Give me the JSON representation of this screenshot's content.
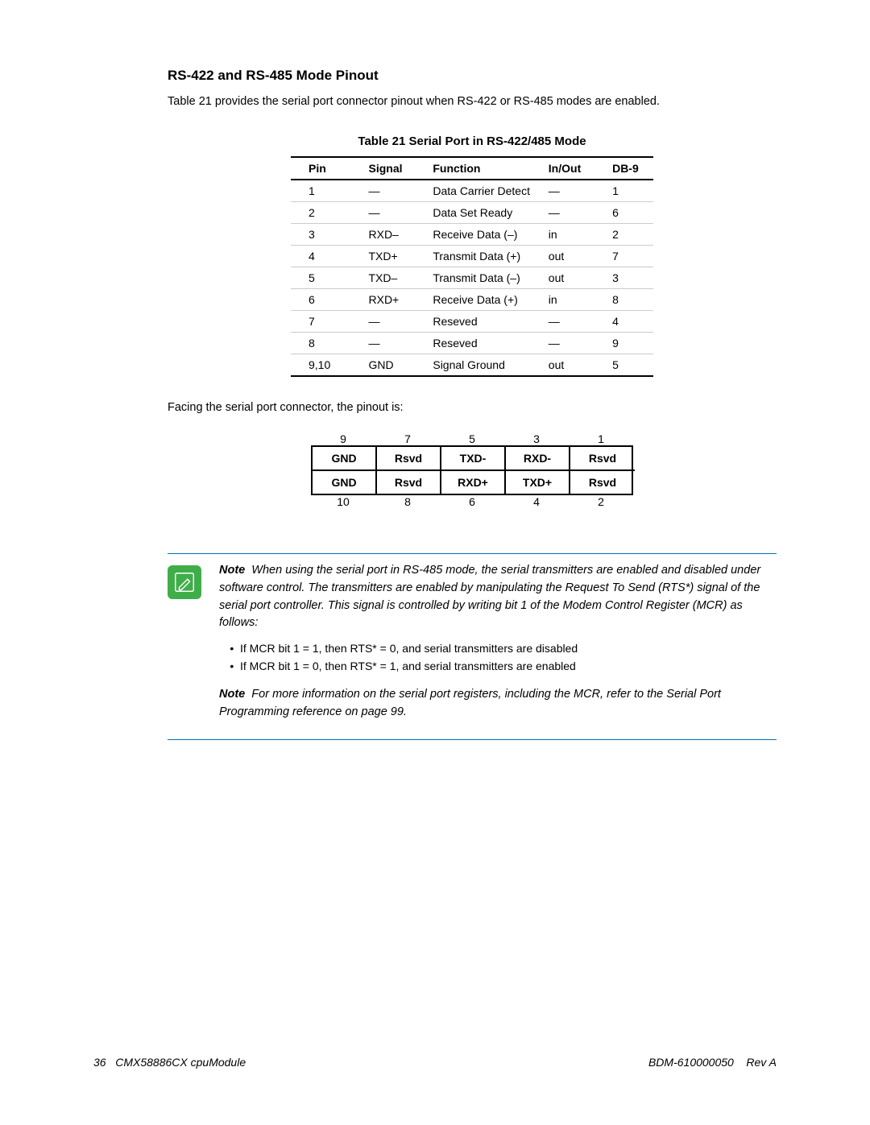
{
  "heading": "RS-422 and RS-485 Mode Pinout",
  "intro": "Table 21 provides the serial port connector pinout when RS-422 or RS-485 modes are enabled.",
  "table_caption": "Table 21     Serial Port in RS-422/485 Mode",
  "table": {
    "headers": {
      "pin": "Pin",
      "signal": "Signal",
      "function": "Function",
      "inout": "In/Out",
      "db9": "DB-9"
    },
    "rows": [
      {
        "pin": "1",
        "signal": "—",
        "function": "Data Carrier Detect",
        "inout": "—",
        "db9": "1"
      },
      {
        "pin": "2",
        "signal": "—",
        "function": "Data Set Ready",
        "inout": "—",
        "db9": "6"
      },
      {
        "pin": "3",
        "signal": "RXD–",
        "function": "Receive Data (–)",
        "inout": "in",
        "db9": "2"
      },
      {
        "pin": "4",
        "signal": "TXD+",
        "function": "Transmit Data (+)",
        "inout": "out",
        "db9": "7"
      },
      {
        "pin": "5",
        "signal": "TXD–",
        "function": "Transmit Data (–)",
        "inout": "out",
        "db9": "3"
      },
      {
        "pin": "6",
        "signal": "RXD+",
        "function": "Receive Data (+)",
        "inout": "in",
        "db9": "8"
      },
      {
        "pin": "7",
        "signal": "—",
        "function": "Reseved",
        "inout": "—",
        "db9": "4"
      },
      {
        "pin": "8",
        "signal": "—",
        "function": "Reseved",
        "inout": "—",
        "db9": "9"
      },
      {
        "pin": "9,10",
        "signal": "GND",
        "function": "Signal Ground",
        "inout": "out",
        "db9": "5"
      }
    ]
  },
  "facing_text": "Facing the serial port connector, the pinout is:",
  "pin_diagram": {
    "top_numbers": [
      "9",
      "7",
      "5",
      "3",
      "1"
    ],
    "row1": [
      "GND",
      "Rsvd",
      "TXD-",
      "RXD-",
      "Rsvd"
    ],
    "row2": [
      "GND",
      "Rsvd",
      "RXD+",
      "TXD+",
      "Rsvd"
    ],
    "bottom_numbers": [
      "10",
      "8",
      "6",
      "4",
      "2"
    ]
  },
  "note1": {
    "lead": "Note",
    "body": "When using the serial port in RS-485 mode, the serial transmitters are enabled and disabled under software control. The transmitters are enabled by manipulating the Request To Send (RTS*) signal of the serial port controller. This signal is controlled by writing bit 1 of the Modem Control Register (MCR) as follows:"
  },
  "bullets": [
    "If MCR bit 1 = 1, then RTS* = 0, and serial transmitters are disabled",
    "If MCR bit 1 = 0, then RTS* = 1, and serial transmitters are enabled"
  ],
  "note2": {
    "lead": "Note",
    "body": "For more information on the serial port registers, including the MCR, refer to the Serial Port Programming reference on page 99."
  },
  "footer": {
    "page": "36",
    "product": "CMX58886CX cpuModule",
    "docid": "BDM-610000050",
    "rev": "Rev A"
  }
}
